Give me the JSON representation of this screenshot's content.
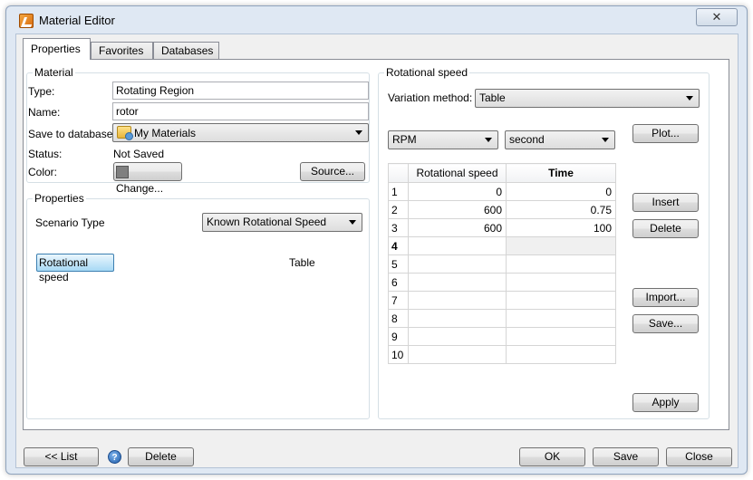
{
  "window": {
    "title": "Material Editor",
    "close_glyph": "✕"
  },
  "tabs": [
    {
      "label": "Properties",
      "active": true
    },
    {
      "label": "Favorites",
      "active": false
    },
    {
      "label": "Databases",
      "active": false
    }
  ],
  "material": {
    "group_title": "Material",
    "type_label": "Type:",
    "type_value": "Rotating Region",
    "name_label": "Name:",
    "name_value": "rotor",
    "save_label": "Save to database:",
    "save_value": "My Materials",
    "status_label": "Status:",
    "status_value": "Not Saved",
    "color_label": "Color:",
    "color_button": "Change...",
    "color_swatch": "#7f7f7f",
    "source_button": "Source..."
  },
  "properties": {
    "group_title": "Properties",
    "scenario_label": "Scenario Type",
    "scenario_value": "Known Rotational Speed",
    "rot_button": "Rotational speed",
    "rot_value": "Table"
  },
  "rotational": {
    "group_title": "Rotational speed",
    "variation_label": "Variation method:",
    "variation_value": "Table",
    "unit_x": "RPM",
    "unit_time": "second",
    "plot_button": "Plot...",
    "insert_button": "Insert",
    "delete_button": "Delete",
    "import_button": "Import...",
    "save_button": "Save...",
    "apply_button": "Apply",
    "table": {
      "headers": [
        "Rotational speed",
        "Time"
      ],
      "rows": [
        {
          "n": "1",
          "speed": "0",
          "time": "0"
        },
        {
          "n": "2",
          "speed": "600",
          "time": "0.75"
        },
        {
          "n": "3",
          "speed": "600",
          "time": "100"
        },
        {
          "n": "4",
          "speed": "",
          "time": ""
        },
        {
          "n": "5",
          "speed": "",
          "time": ""
        },
        {
          "n": "6",
          "speed": "",
          "time": ""
        },
        {
          "n": "7",
          "speed": "",
          "time": ""
        },
        {
          "n": "8",
          "speed": "",
          "time": ""
        },
        {
          "n": "9",
          "speed": "",
          "time": ""
        },
        {
          "n": "10",
          "speed": "",
          "time": ""
        }
      ]
    }
  },
  "footer": {
    "list_button": "<< List",
    "help_glyph": "?",
    "delete_button": "Delete",
    "ok_button": "OK",
    "save_button": "Save",
    "close_button": "Close"
  }
}
